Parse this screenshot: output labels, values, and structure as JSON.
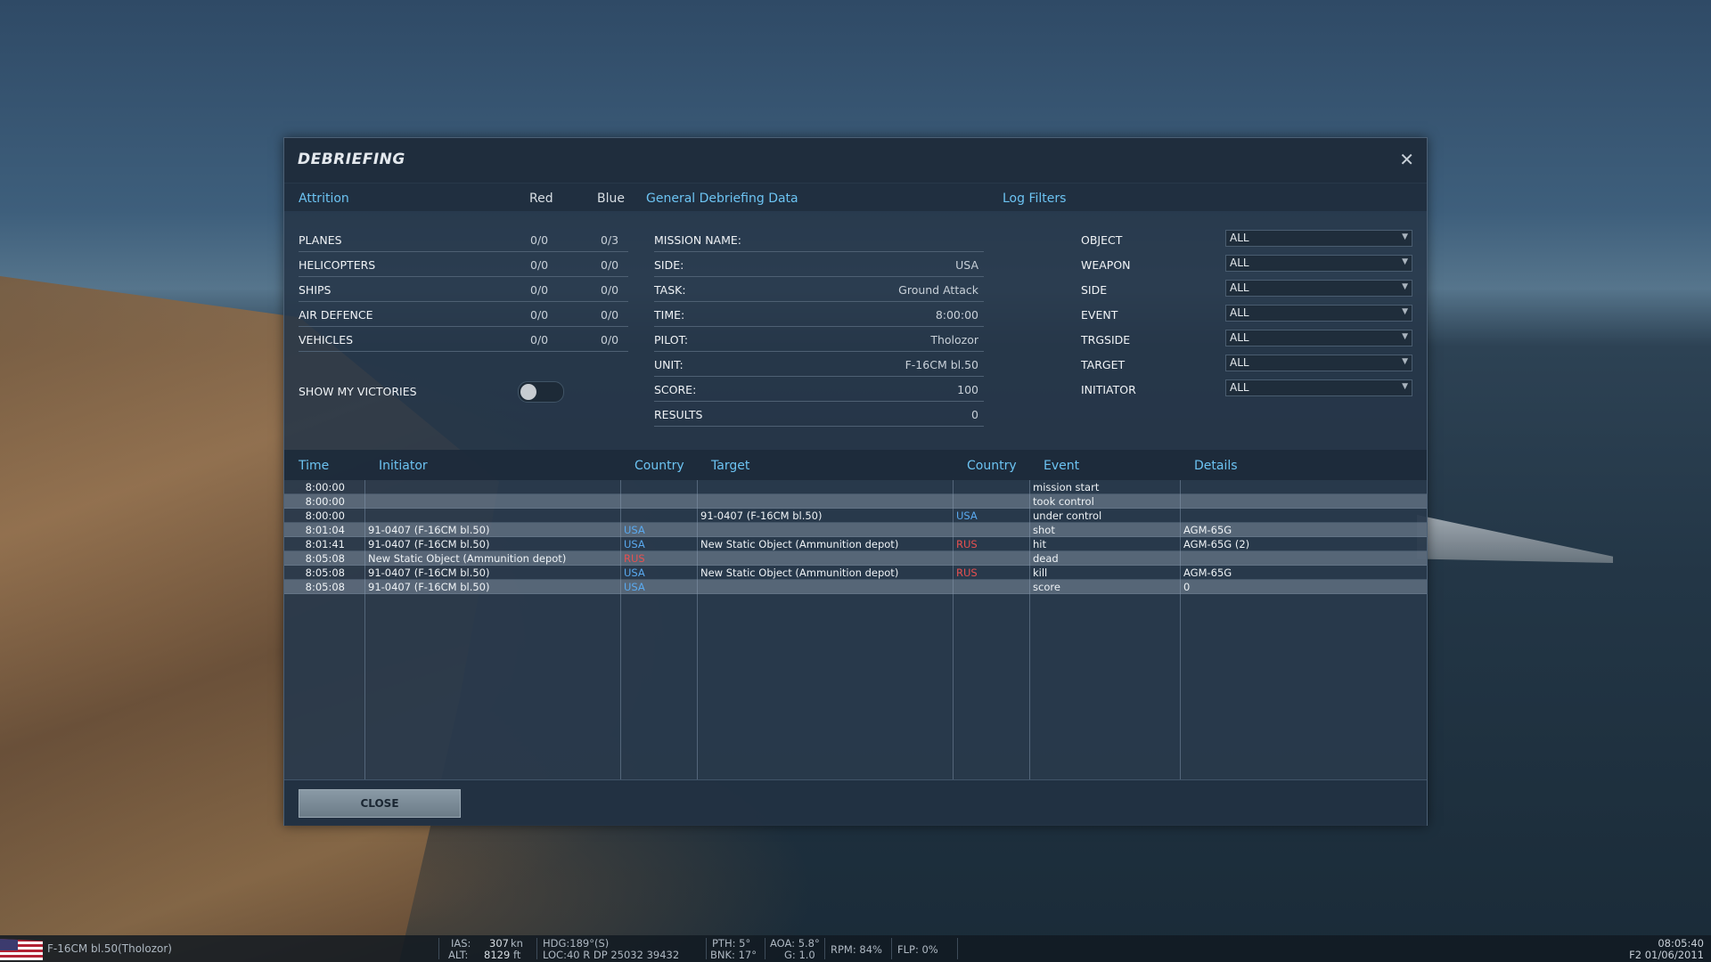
{
  "dialog": {
    "title": "DEBRIEFING",
    "attrition": {
      "header": "Attrition",
      "col_red": "Red",
      "col_blue": "Blue",
      "rows": [
        {
          "label": "PLANES",
          "red": "0/0",
          "blue": "0/3"
        },
        {
          "label": "HELICOPTERS",
          "red": "0/0",
          "blue": "0/0"
        },
        {
          "label": "SHIPS",
          "red": "0/0",
          "blue": "0/0"
        },
        {
          "label": "AIR DEFENCE",
          "red": "0/0",
          "blue": "0/0"
        },
        {
          "label": "VEHICLES",
          "red": "0/0",
          "blue": "0/0"
        }
      ],
      "show_victories_label": "SHOW MY VICTORIES",
      "show_victories_on": false
    },
    "general": {
      "header": "General Debriefing Data",
      "rows": [
        {
          "label": "MISSION NAME:",
          "value": ""
        },
        {
          "label": "SIDE:",
          "value": "USA"
        },
        {
          "label": "TASK:",
          "value": "Ground Attack"
        },
        {
          "label": "TIME:",
          "value": "8:00:00"
        },
        {
          "label": "PILOT:",
          "value": "Tholozor"
        },
        {
          "label": "UNIT:",
          "value": "F-16CM bl.50"
        },
        {
          "label": "SCORE:",
          "value": "100"
        },
        {
          "label": "RESULTS",
          "value": "0"
        }
      ]
    },
    "filters": {
      "header": "Log Filters",
      "rows": [
        {
          "label": "OBJECT",
          "value": "ALL"
        },
        {
          "label": "WEAPON",
          "value": "ALL"
        },
        {
          "label": "SIDE",
          "value": "ALL"
        },
        {
          "label": "EVENT",
          "value": "ALL"
        },
        {
          "label": "TRGSIDE",
          "value": "ALL"
        },
        {
          "label": "TARGET",
          "value": "ALL"
        },
        {
          "label": "INITIATOR",
          "value": "ALL"
        }
      ]
    },
    "log": {
      "columns": {
        "time": "Time",
        "initiator": "Initiator",
        "country1": "Country",
        "target": "Target",
        "country2": "Country",
        "event": "Event",
        "details": "Details"
      },
      "rows": [
        {
          "time": "8:00:00",
          "initiator": "",
          "country1": "",
          "target": "",
          "country2": "",
          "event": "mission start",
          "details": ""
        },
        {
          "time": "8:00:00",
          "initiator": "",
          "country1": "",
          "target": "",
          "country2": "",
          "event": "took control",
          "details": ""
        },
        {
          "time": "8:00:00",
          "initiator": "",
          "country1": "",
          "target": "91-0407 (F-16CM bl.50)",
          "country2": "USA",
          "event": "under control",
          "details": ""
        },
        {
          "time": "8:01:04",
          "initiator": "91-0407 (F-16CM bl.50)",
          "country1": "USA",
          "target": "",
          "country2": "",
          "event": "shot",
          "details": "AGM-65G"
        },
        {
          "time": "8:01:41",
          "initiator": "91-0407 (F-16CM bl.50)",
          "country1": "USA",
          "target": "New Static Object (Ammunition depot)",
          "country2": "RUS",
          "event": "hit",
          "details": "AGM-65G (2)"
        },
        {
          "time": "8:05:08",
          "initiator": "New Static Object (Ammunition depot)",
          "country1": "RUS",
          "target": "",
          "country2": "",
          "event": "dead",
          "details": ""
        },
        {
          "time": "8:05:08",
          "initiator": "91-0407 (F-16CM bl.50)",
          "country1": "USA",
          "target": "New Static Object (Ammunition depot)",
          "country2": "RUS",
          "event": "kill",
          "details": "AGM-65G"
        },
        {
          "time": "8:05:08",
          "initiator": "91-0407 (F-16CM bl.50)",
          "country1": "USA",
          "target": "",
          "country2": "",
          "event": "score",
          "details": "0"
        }
      ]
    },
    "close_button": "CLOSE",
    "close_icon": "close-icon"
  },
  "hud": {
    "aircraft": "F-16CM bl.50(Tholozor)",
    "ias_label": "IAS:",
    "ias_value": "307",
    "ias_unit": "kn",
    "alt_label": "ALT:",
    "alt_value": "8129",
    "alt_unit": "ft",
    "hdg": "HDG:189°(S)",
    "loc": "LOC:40 R DP 25032 39432",
    "pth": "PTH: 5°",
    "bnk": "BNK: 17°",
    "aoa": "AOA: 5.8°",
    "g": "G: 1.0",
    "rpm": "RPM: 84%",
    "flp": "FLP: 0%",
    "time": "08:05:40",
    "date": "F2 01/06/2011"
  },
  "colors": {
    "accent": "#6cc3f2",
    "usa": "#5aaaf0",
    "rus": "#e65050"
  }
}
